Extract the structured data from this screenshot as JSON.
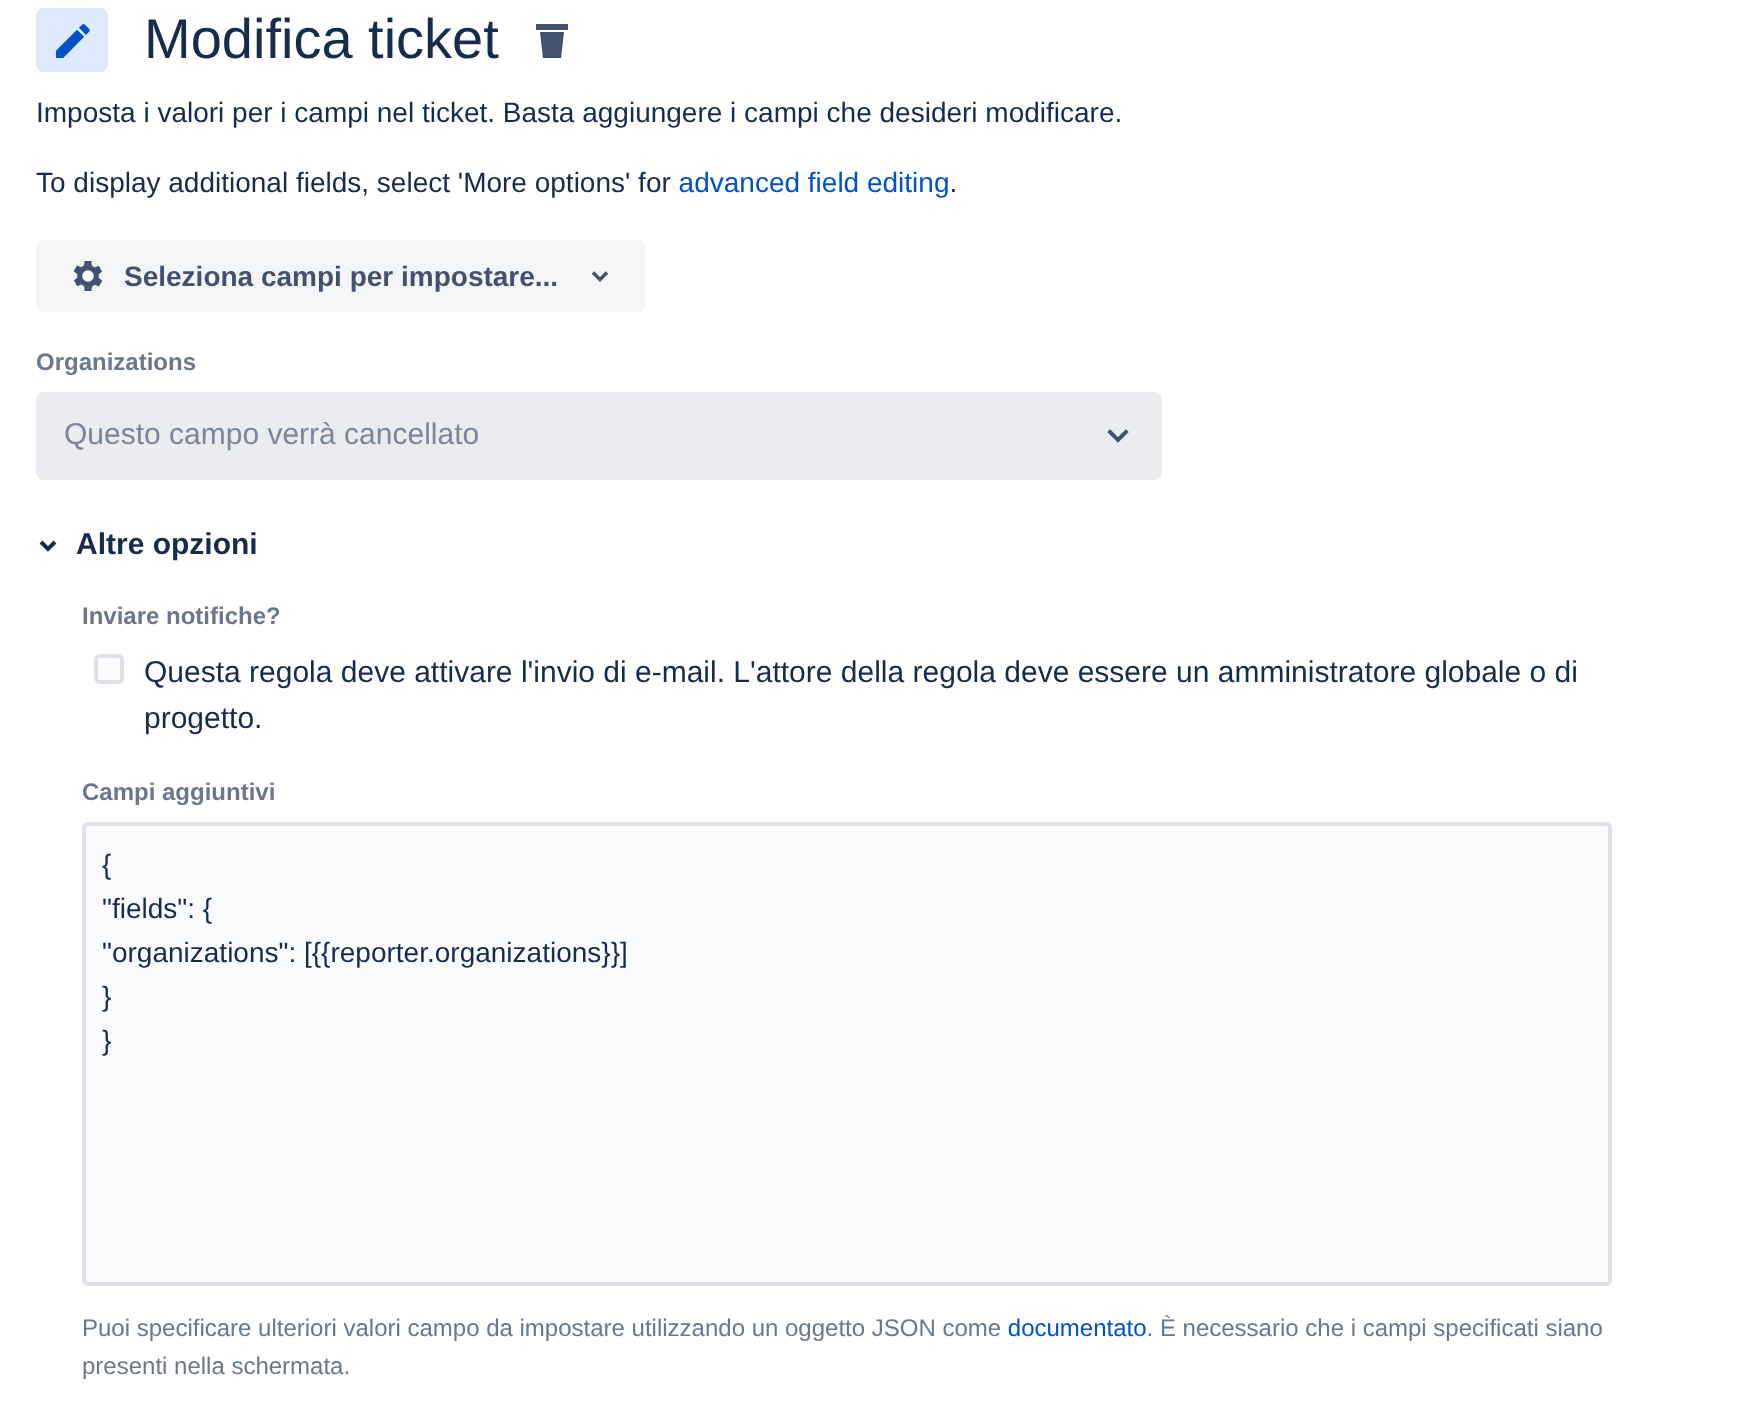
{
  "header": {
    "title": "Modifica ticket"
  },
  "intro": "Imposta i valori per i campi nel ticket. Basta aggiungere i campi che desideri modificare.",
  "more_info": {
    "before": "To display additional fields, select 'More options' for ",
    "link": "advanced field editing",
    "after": "."
  },
  "field_picker": {
    "label": "Seleziona campi per impostare..."
  },
  "organizations": {
    "label": "Organizations",
    "placeholder": "Questo campo verrà cancellato"
  },
  "more_options": {
    "title": "Altre opzioni",
    "expanded": true,
    "notifications": {
      "label": "Inviare notifiche?",
      "checkbox": {
        "text": "Questa regola deve attivare l'invio di e-mail. L'attore della regola deve essere un amministratore globale o di progetto.",
        "checked": false
      }
    },
    "additional_fields": {
      "label": "Campi aggiuntivi",
      "value": [
        "{",
        "\"fields\": {",
        "\"organizations\": [{{reporter.organizations}}]",
        "}",
        "}"
      ],
      "help": {
        "before": "Puoi specificare ulteriori valori campo da impostare utilizzando un oggetto JSON come ",
        "link": "documentato",
        "after": ". È necessario che i campi specificati siano presenti nella schermata."
      }
    }
  }
}
